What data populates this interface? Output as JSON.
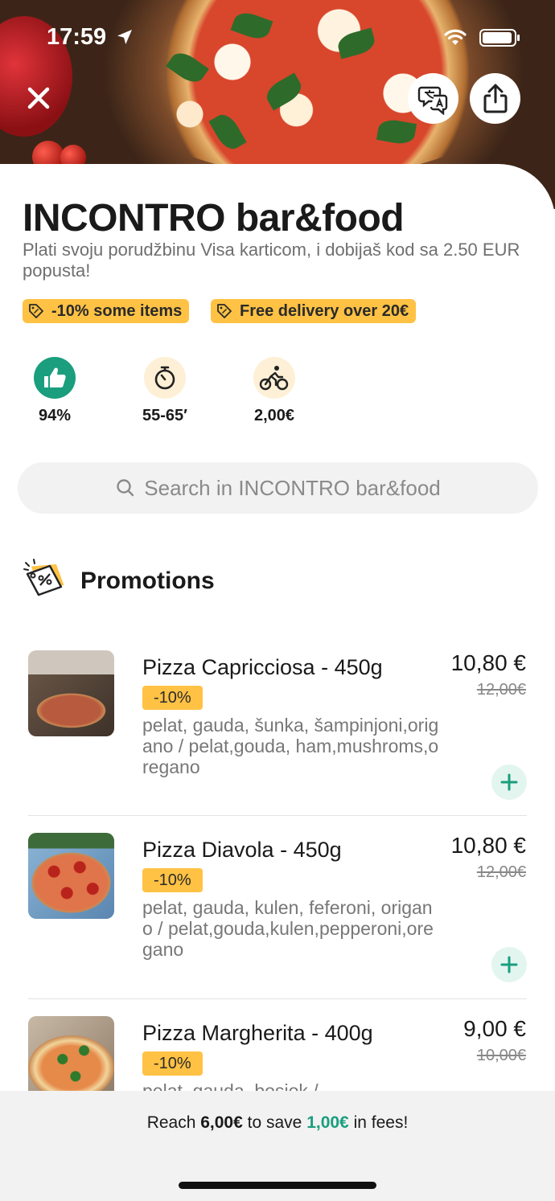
{
  "status_bar": {
    "time": "17:59"
  },
  "restaurant": {
    "name": "INCONTRO bar&food",
    "subtitle": "Plati svoju porudžbinu Visa karticom, i dobijaš kod sa 2.50 EUR popusta!",
    "tags": [
      "-10% some items",
      "Free delivery over 20€"
    ],
    "stats": {
      "rating": "94%",
      "delivery_time": "55-65′",
      "delivery_fee": "2,00€"
    }
  },
  "search": {
    "placeholder": "Search in INCONTRO bar&food"
  },
  "section": {
    "title": "Promotions"
  },
  "items": [
    {
      "name": "Pizza Capricciosa  - 450g",
      "badge": "-10%",
      "description": "pelat, gauda, šunka, šampinjoni,origano / pelat,gouda, ham,mushroms,oregano",
      "price": "10,80 €",
      "old_price": "12,00€"
    },
    {
      "name": "Pizza Diavola  - 450g",
      "badge": "-10%",
      "description": "pelat, gauda, kulen, feferoni, origano / pelat,gouda,kulen,pepperoni,oregano",
      "price": "10,80 €",
      "old_price": "12,00€"
    },
    {
      "name": "Pizza Margherita  - 400g",
      "badge": "-10%",
      "description": "pelat, gauda, bosiok /",
      "price": "9,00 €",
      "old_price": "10,00€"
    }
  ],
  "bottom_bar": {
    "prefix": "Reach ",
    "amount": "6,00€",
    "middle": " to save ",
    "savings": "1,00€",
    "suffix": " in fees!"
  },
  "colors": {
    "accent_yellow": "#ffc244",
    "accent_green": "#1a9e7e",
    "rating_green": "#1a9e7e"
  },
  "icons": [
    "location-arrow-icon",
    "wifi-icon",
    "battery-icon",
    "close-icon",
    "translate-icon",
    "share-icon",
    "tag-icon",
    "thumbs-up-icon",
    "timer-icon",
    "cyclist-icon",
    "search-icon",
    "promotion-icon",
    "plus-icon"
  ]
}
